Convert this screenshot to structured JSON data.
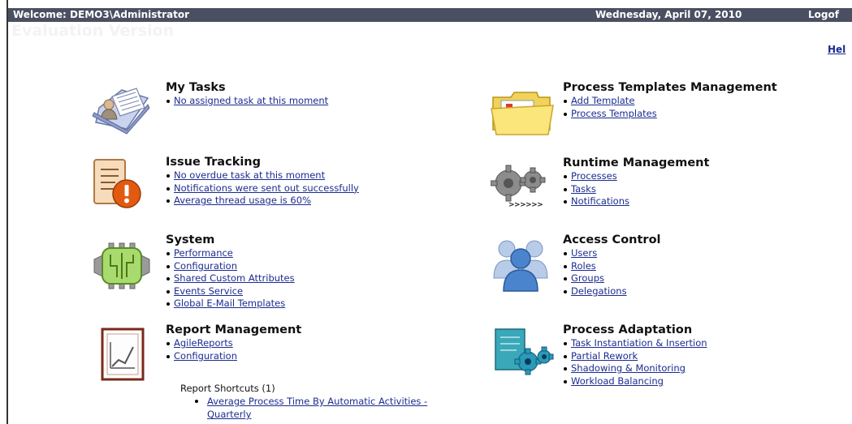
{
  "header": {
    "welcome": "Welcome: DEMO3\\Administrator",
    "date": "Wednesday, April 07, 2010",
    "logoff": "Logof"
  },
  "watermark": "Evaluation Version",
  "help_link": "Hel",
  "colors": {
    "topbar": "#4a5061",
    "link": "#1b2c8f"
  },
  "sections": {
    "my_tasks": {
      "icon": "tasks-folder-icon",
      "title": "My Tasks",
      "links": [
        "No assigned task at this moment"
      ]
    },
    "issue_tracking": {
      "icon": "issue-alert-icon",
      "title": "Issue Tracking",
      "links": [
        "No overdue task at this moment",
        "Notifications were sent out successfully",
        "Average thread usage is 60%"
      ]
    },
    "system": {
      "icon": "system-chip-icon",
      "title": "System",
      "links": [
        "Performance",
        "Configuration",
        "Shared Custom Attributes",
        "Events Service",
        "Global E-Mail Templates"
      ]
    },
    "report_management": {
      "icon": "report-chart-icon",
      "title": "Report Management",
      "links": [
        "AgileReports",
        "Configuration"
      ]
    },
    "process_templates": {
      "icon": "templates-folder-icon",
      "title": "Process Templates Management",
      "links": [
        "Add Template",
        "Process Templates"
      ]
    },
    "runtime_management": {
      "icon": "runtime-gears-icon",
      "icon_caption": ">>>>>>",
      "title": "Runtime Management",
      "links": [
        "Processes",
        "Tasks",
        "Notifications"
      ]
    },
    "access_control": {
      "icon": "users-group-icon",
      "title": "Access Control",
      "links": [
        "Users",
        "Roles",
        "Groups",
        "Delegations"
      ]
    },
    "process_adaptation": {
      "icon": "adaptation-gear-icon",
      "title": "Process Adaptation",
      "links": [
        "Task Instantiation & Insertion",
        "Partial Rework",
        "Shadowing & Monitoring",
        "Workload Balancing"
      ]
    }
  },
  "report_shortcuts": {
    "title": "Report Shortcuts (1)",
    "items": [
      "Average Process Time By Automatic Activities - Quarterly"
    ]
  }
}
